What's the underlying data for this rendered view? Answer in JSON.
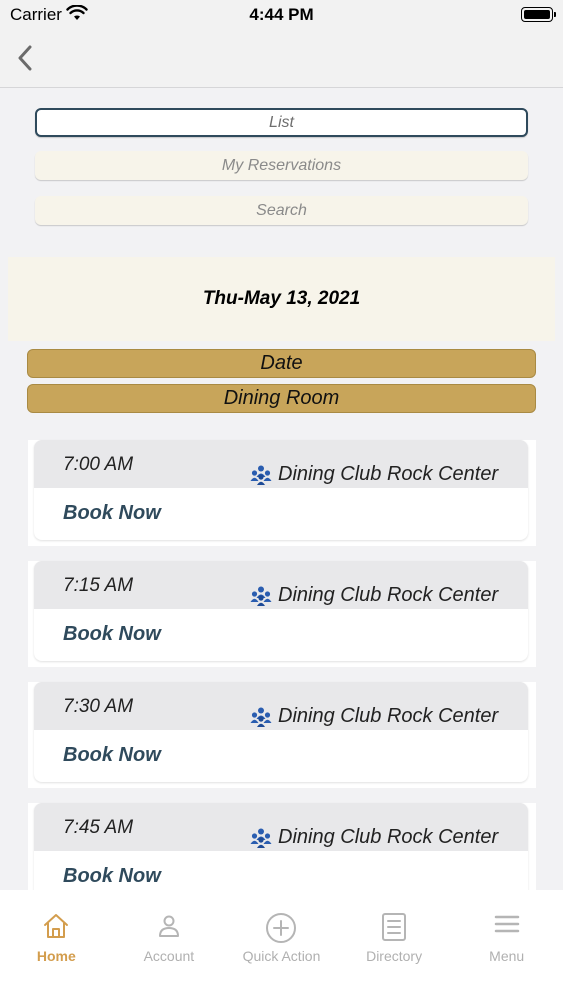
{
  "status_bar": {
    "carrier": "Carrier",
    "time": "4:44 PM"
  },
  "segments": {
    "list": "List",
    "my_reservations": "My Reservations",
    "search": "Search"
  },
  "date_header": "Thu-May 13, 2021",
  "filters": {
    "date": "Date",
    "dining_room": "Dining Room"
  },
  "slots": [
    {
      "time": "7:00 AM",
      "location": "Dining Club Rock Center",
      "action": "Book Now"
    },
    {
      "time": "7:15 AM",
      "location": "Dining Club Rock Center",
      "action": "Book Now"
    },
    {
      "time": "7:30 AM",
      "location": "Dining Club Rock Center",
      "action": "Book Now"
    },
    {
      "time": "7:45 AM",
      "location": "Dining Club Rock Center",
      "action": "Book Now"
    }
  ],
  "tabs": [
    {
      "label": "Home",
      "icon": "home-icon",
      "active": true
    },
    {
      "label": "Account",
      "icon": "person-icon",
      "active": false
    },
    {
      "label": "Quick Action",
      "icon": "plus-circle-icon",
      "active": false
    },
    {
      "label": "Directory",
      "icon": "list-icon",
      "active": false
    },
    {
      "label": "Menu",
      "icon": "hamburger-icon",
      "active": false
    }
  ],
  "colors": {
    "accent": "#d39d4d",
    "navy": "#2f4a5c",
    "gold": "#c8a55a",
    "cream": "#f7f4ea"
  }
}
